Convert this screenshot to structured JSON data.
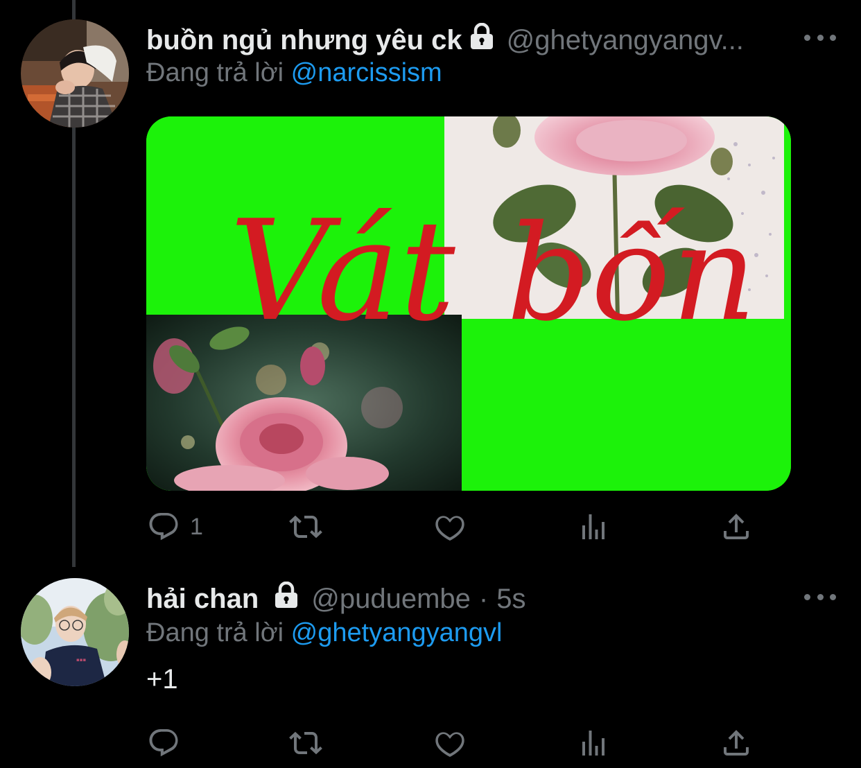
{
  "tweets": [
    {
      "display_name": "buồn ngủ nhưng yêu ck",
      "handle": "@ghetyangyangv...",
      "time": "",
      "reply_prefix": "Đang trả lời",
      "reply_to": "@narcissism",
      "text": "",
      "media_text_1": "Vát",
      "media_text_2": "bốn",
      "reply_count": "1"
    },
    {
      "display_name": "hải chan",
      "handle": "@puduembe",
      "separator": "·",
      "time": "5s",
      "reply_prefix": "Đang trả lời",
      "reply_to": "@ghetyangyangvl",
      "text": "+1",
      "reply_count": ""
    }
  ],
  "colors": {
    "background": "#000000",
    "text_primary": "#e7e9ea",
    "text_secondary": "#71767b",
    "link": "#1d9bf0",
    "thread_line": "#333639",
    "media_green": "#1cf20a",
    "media_script_red": "#d31b22"
  },
  "icons": [
    "lock-icon",
    "more-icon",
    "reply-icon",
    "retweet-icon",
    "like-icon",
    "analytics-icon",
    "share-icon"
  ]
}
